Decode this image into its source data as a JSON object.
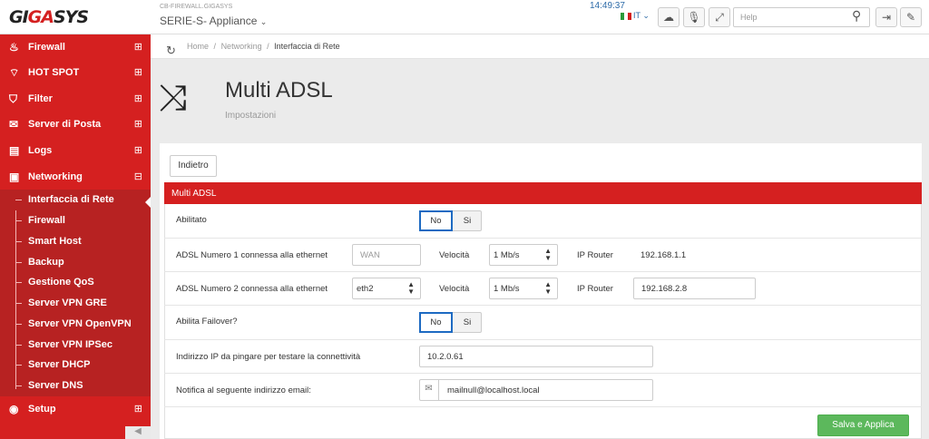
{
  "header": {
    "logo_gi": "GI",
    "logo_ga": "GA",
    "logo_sys": "SYS",
    "hostname": "CB-FIREWALL.GIGASYS",
    "appliance": "SERIE-S- Appliance",
    "time": "14:49:37",
    "language": "IT",
    "search_placeholder": "Help"
  },
  "sidebar": {
    "items": [
      {
        "label": "Firewall",
        "icon": "fire-icon",
        "state": "⊞"
      },
      {
        "label": "HOT SPOT",
        "icon": "wifi-icon",
        "state": "⊞"
      },
      {
        "label": "Filter",
        "icon": "shield-icon",
        "state": "⊞"
      },
      {
        "label": "Server di Posta",
        "icon": "mail-icon",
        "state": "⊞"
      },
      {
        "label": "Logs",
        "icon": "logs-icon",
        "state": "⊞"
      },
      {
        "label": "Networking",
        "icon": "network-icon",
        "state": "⊟"
      },
      {
        "label": "Setup",
        "icon": "setup-icon",
        "state": "⊞"
      }
    ],
    "networking_sub": [
      "Interfaccia di Rete",
      "Firewall",
      "Smart Host",
      "Backup",
      "Gestione QoS",
      "Server VPN GRE",
      "Server VPN OpenVPN",
      "Server VPN IPSec",
      "Server DHCP",
      "Server DNS"
    ]
  },
  "breadcrumb": {
    "home": "Home",
    "section": "Networking",
    "current": "Interfaccia di Rete",
    "sep": "/"
  },
  "page": {
    "title": "Multi ADSL",
    "subtitle": "Impostazioni",
    "back_label": "Indietro"
  },
  "form": {
    "panel_title": "Multi ADSL",
    "enabled_label": "Abilitato",
    "no_label": "No",
    "si_label": "Si",
    "adsl1_label": "ADSL Numero 1 connessa alla ethernet",
    "adsl1_iface_placeholder": "WAN",
    "speed_label": "Velocità",
    "adsl1_speed": "1 Mb/s",
    "router_label": "IP Router",
    "adsl1_router": "192.168.1.1",
    "adsl2_label": "ADSL Numero 2 connessa alla ethernet",
    "adsl2_iface": "eth2",
    "adsl2_speed": "1 Mb/s",
    "adsl2_router": "192.168.2.8",
    "failover_label": "Abilita Failover?",
    "ping_label": "Indirizzo IP da pingare per testare la connettività",
    "ping_ip": "10.2.0.61",
    "notify_label": "Notifica al seguente indirizzo email:",
    "notify_email": "mailnull@localhost.local",
    "submit_label": "Salva e Applica"
  },
  "colors": {
    "brand_red": "#d52020",
    "sub_red": "#b72222",
    "focus_blue": "#1d6ac2",
    "success_green": "#5cb85c"
  }
}
